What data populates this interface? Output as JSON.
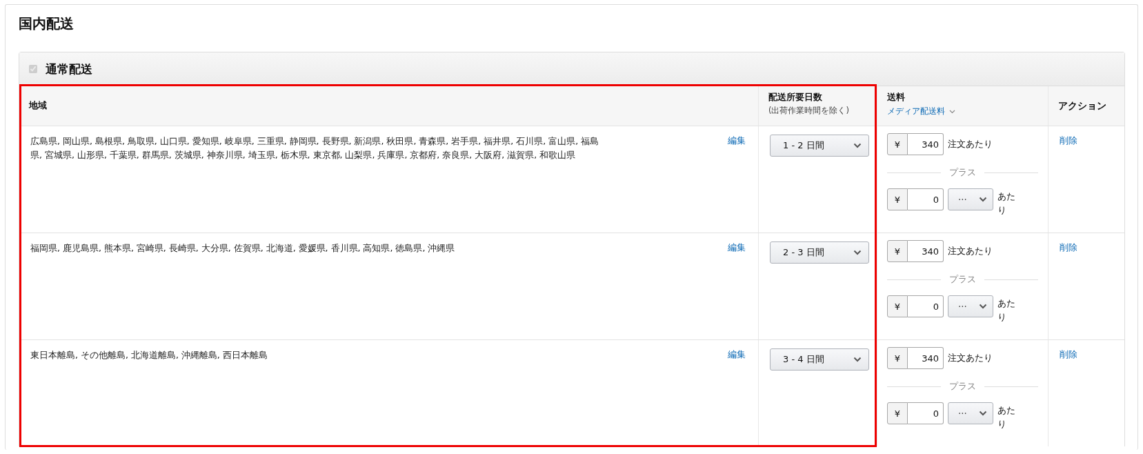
{
  "section_title": "国内配送",
  "shipping_option": {
    "label": "通常配送",
    "checked": true,
    "disabled": true
  },
  "table": {
    "columns": [
      {
        "label": "地域"
      },
      {
        "label": "配送所要日数",
        "sublabel": "(出荷作業時間を除く)"
      },
      {
        "label": "送料",
        "dropdown": "メディア配送料"
      },
      {
        "label": "アクション"
      }
    ],
    "rows": [
      {
        "regions": "広島県, 岡山県, 島根県, 鳥取県, 山口県, 愛知県, 岐阜県, 三重県, 静岡県, 長野県, 新潟県, 秋田県, 青森県, 岩手県, 福井県, 石川県, 富山県, 福島県, 宮城県, 山形県, 千葉県, 群馬県, 茨城県, 神奈川県, 埼玉県, 栃木県, 東京都, 山梨県, 兵庫県, 京都府, 奈良県, 大阪府, 滋賀県, 和歌山県",
        "edit_link": "編集",
        "transit_time": "1 - 2 日間",
        "per_order": {
          "currency": "¥",
          "value": "340",
          "unit": "注文あたり"
        },
        "plus_label": "プラス",
        "per_item": {
          "currency": "¥",
          "value": "0",
          "unit_select": "···",
          "unit": "あたり"
        },
        "action": "削除"
      },
      {
        "regions": "福岡県, 鹿児島県, 熊本県, 宮崎県, 長崎県, 大分県, 佐賀県, 北海道, 愛媛県, 香川県, 高知県, 徳島県, 沖縄県",
        "edit_link": "編集",
        "transit_time": "2 - 3 日間",
        "per_order": {
          "currency": "¥",
          "value": "340",
          "unit": "注文あたり"
        },
        "plus_label": "プラス",
        "per_item": {
          "currency": "¥",
          "value": "0",
          "unit_select": "···",
          "unit": "あたり"
        },
        "action": "削除"
      },
      {
        "regions": "東日本離島, その他離島, 北海道離島, 沖縄離島, 西日本離島",
        "edit_link": "編集",
        "transit_time": "3 - 4 日間",
        "per_order": {
          "currency": "¥",
          "value": "340",
          "unit": "注文あたり"
        },
        "plus_label": "プラス",
        "per_item": {
          "currency": "¥",
          "value": "0",
          "unit_select": "···",
          "unit": "あたり"
        },
        "action": "削除"
      }
    ]
  }
}
